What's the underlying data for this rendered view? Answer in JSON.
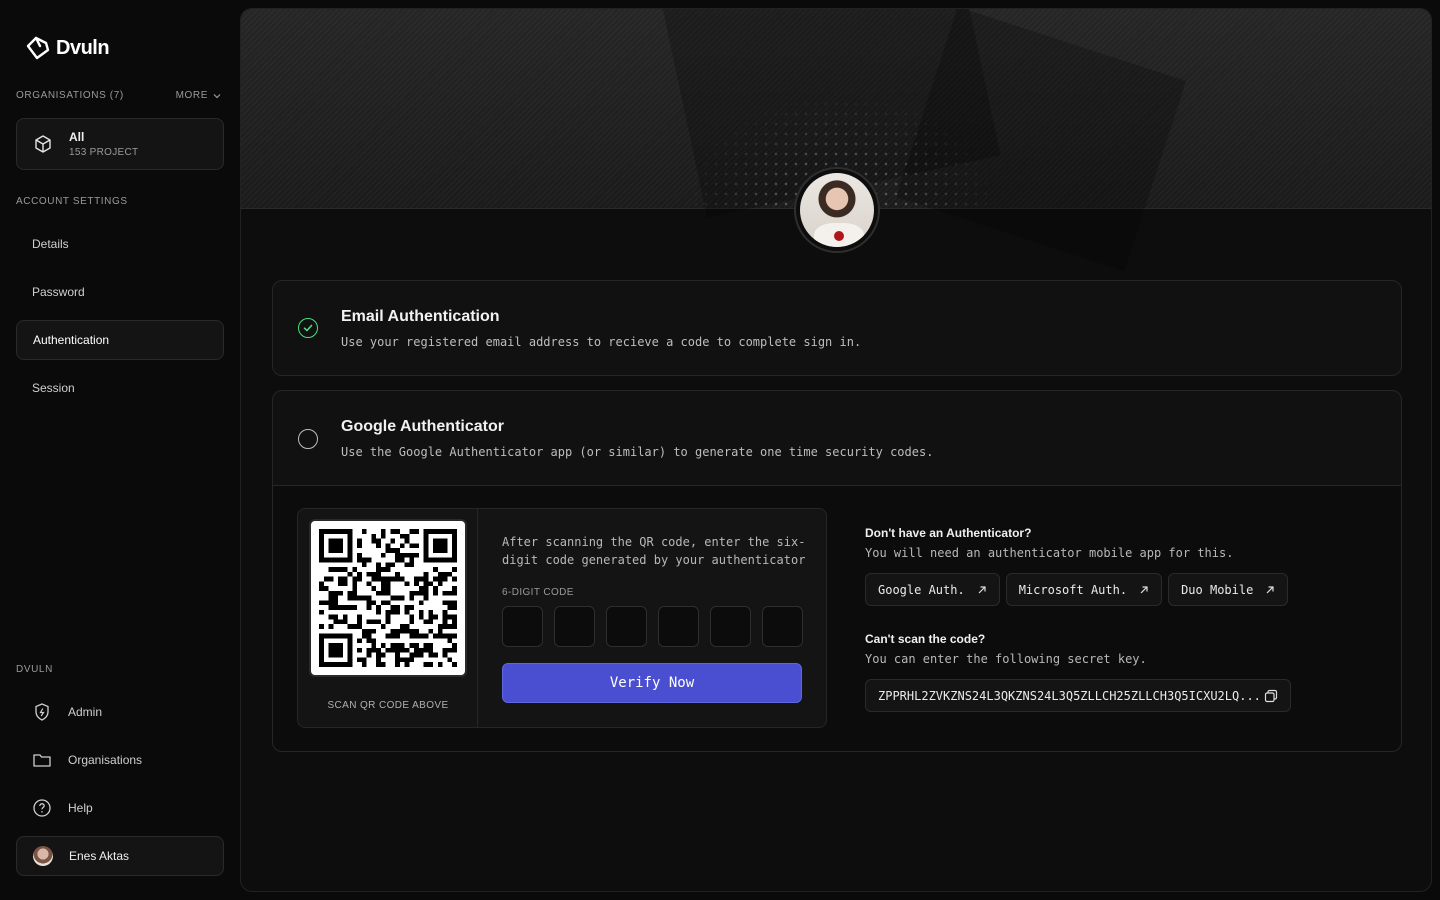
{
  "brand": {
    "name": "Dvuln"
  },
  "sidebar": {
    "orgs_label": "ORGANISATIONS (7)",
    "more_label": "MORE",
    "org_card": {
      "name": "All",
      "sub": "153 PROJECT"
    },
    "account_label": "ACCOUNT SETTINGS",
    "account_items": [
      {
        "label": "Details"
      },
      {
        "label": "Password"
      },
      {
        "label": "Authentication",
        "active": true
      },
      {
        "label": "Session"
      }
    ],
    "dvuln_label": "DVULN",
    "dvuln_items": [
      {
        "label": "Admin",
        "icon": "shield-bolt-icon"
      },
      {
        "label": "Organisations",
        "icon": "folder-icon"
      },
      {
        "label": "Help",
        "icon": "help-circle-icon"
      }
    ],
    "user": {
      "name": "Enes Aktas"
    }
  },
  "email_auth": {
    "title": "Email Authentication",
    "desc": "Use your registered email address to recieve a code to complete sign in.",
    "selected": true
  },
  "google_auth": {
    "title": "Google Authenticator",
    "desc": "Use the Google Authenticator app (or similar) to generate one time security codes.",
    "selected": false,
    "qr_caption": "SCAN QR CODE ABOVE",
    "instructions": "After scanning the QR code, enter the six-digit code generated by your authenticator",
    "code_label": "6-DIGIT CODE",
    "verify_label": "Verify Now",
    "no_app_title": "Don't have an Authenticator?",
    "no_app_desc": "You will need an authenticator mobile app for this.",
    "apps": [
      "Google Auth.",
      "Microsoft Auth.",
      "Duo Mobile"
    ],
    "cant_scan_title": "Can't scan the code?",
    "cant_scan_desc": "You can enter the following secret key.",
    "secret_key": "ZPPRHL2ZVKZNS24L3QKZNS24L3Q5ZLLCH25ZLLCH3Q5ICXU2LQ..."
  },
  "colors": {
    "accent": "#4a4fd1",
    "success": "#4ade80"
  }
}
